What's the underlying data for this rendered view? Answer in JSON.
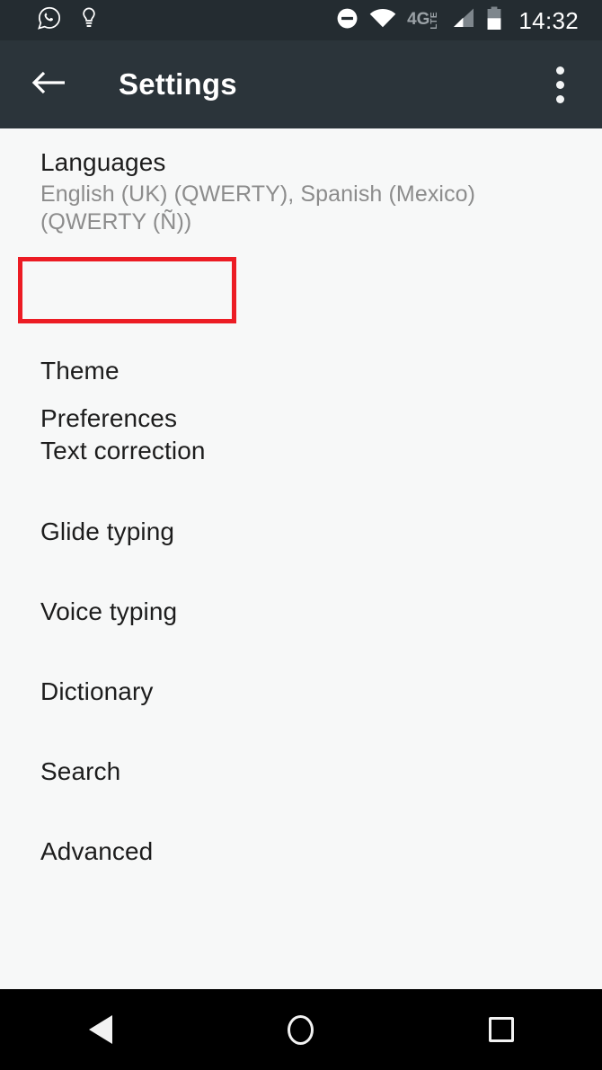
{
  "status_bar": {
    "background": "#242c31",
    "left_icons": [
      "whatsapp-icon",
      "lightbulb-icon"
    ],
    "dnd_icon": "do-not-disturb-icon",
    "wifi_icon": "wifi-icon",
    "network_type": "4G",
    "network_suffix": "LTE",
    "signal_icon": "signal-bars-icon",
    "battery_icon": "battery-icon",
    "battery_level_percent": 55,
    "time": "14:32"
  },
  "app_bar": {
    "background": "#2b343a",
    "back_icon": "arrow-left-icon",
    "title": "Settings",
    "overflow_icon": "more-vertical-icon"
  },
  "list": {
    "items": [
      {
        "label": "Languages",
        "subtitle": "English (UK) (QWERTY), Spanish (Mexico) (QWERTY (Ñ))"
      },
      {
        "label": "Preferences",
        "subtitle": ""
      },
      {
        "label": "Theme",
        "subtitle": ""
      },
      {
        "label": "Text correction",
        "subtitle": ""
      },
      {
        "label": "Glide typing",
        "subtitle": ""
      },
      {
        "label": "Voice typing",
        "subtitle": ""
      },
      {
        "label": "Dictionary",
        "subtitle": ""
      },
      {
        "label": "Search",
        "subtitle": ""
      },
      {
        "label": "Advanced",
        "subtitle": ""
      }
    ]
  },
  "annotation": {
    "target_label": "Preferences",
    "color": "#ec1c24"
  },
  "nav_bar": {
    "background": "#000000",
    "back_icon": "triangle-back-icon",
    "home_icon": "circle-home-icon",
    "recents_icon": "square-recents-icon"
  }
}
